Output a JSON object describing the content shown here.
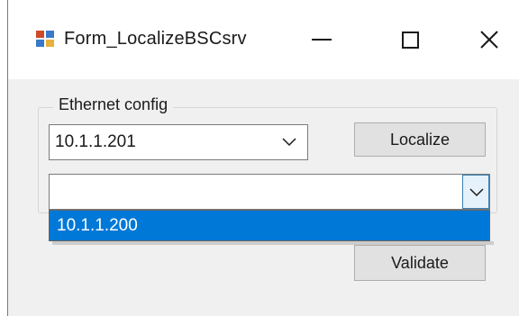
{
  "window": {
    "title": "Form_LocalizeBSCsrv",
    "controls": {
      "minimize": "minimize-icon",
      "maximize": "maximize-icon",
      "close": "close-icon"
    }
  },
  "group": {
    "label": "Ethernet config"
  },
  "ip_combo": {
    "value": "10.1.1.201"
  },
  "buttons": {
    "localize": "Localize",
    "validate": "Validate"
  },
  "result_combo": {
    "value": "",
    "options": [
      "10.1.1.200"
    ],
    "highlighted_index": 0
  },
  "colors": {
    "selection": "#0078d7",
    "window_bg": "#f0f0f0",
    "button_bg": "#e1e1e1"
  }
}
